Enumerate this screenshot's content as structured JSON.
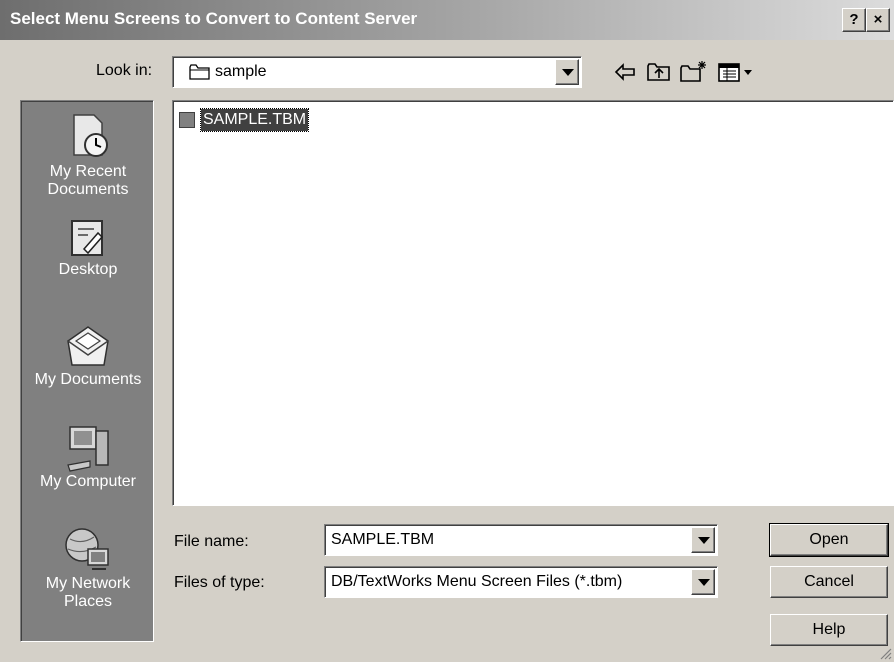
{
  "window": {
    "title": "Select Menu Screens to Convert to Content Server",
    "help_btn": "?",
    "close_btn": "×"
  },
  "lookin": {
    "label": "Look in:",
    "value": "sample"
  },
  "places": [
    {
      "label": "My Recent Documents",
      "icon": "recent-documents-icon"
    },
    {
      "label": "Desktop",
      "icon": "desktop-icon"
    },
    {
      "label": "My Documents",
      "icon": "my-documents-icon"
    },
    {
      "label": "My Computer",
      "icon": "my-computer-icon"
    },
    {
      "label": "My Network Places",
      "icon": "network-places-icon"
    }
  ],
  "files": [
    {
      "name": "SAMPLE.TBM",
      "selected": true
    }
  ],
  "filename": {
    "label": "File name:",
    "value": "SAMPLE.TBM"
  },
  "filetype": {
    "label": "Files of type:",
    "value": "DB/TextWorks Menu Screen Files (*.tbm)"
  },
  "buttons": {
    "open": "Open",
    "cancel": "Cancel",
    "help": "Help"
  },
  "colors": {
    "dialog_bg": "#d4d0c8",
    "places_bg": "#808080",
    "selection_bg": "#404040"
  }
}
